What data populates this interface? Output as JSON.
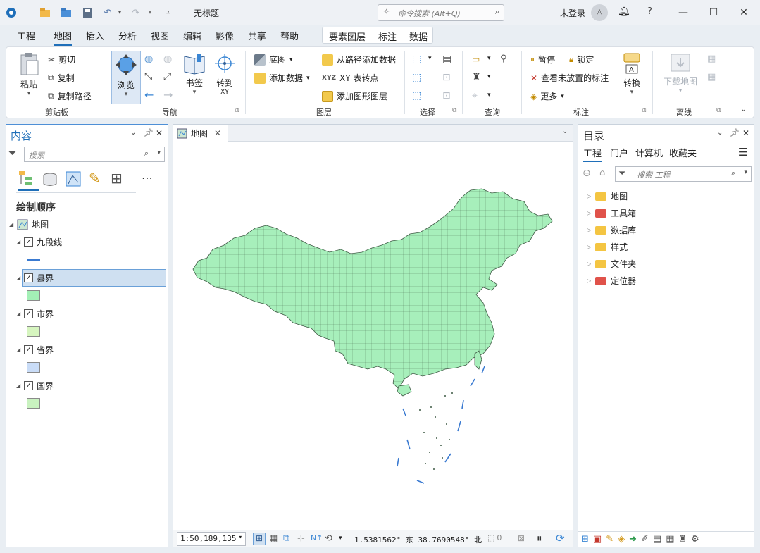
{
  "titlebar": {
    "doc_title": "无标题",
    "command_search_placeholder": "命令搜索 (Alt+Q)",
    "login": "未登录",
    "help": "?"
  },
  "menu": {
    "tabs": [
      "工程",
      "地图",
      "插入",
      "分析",
      "视图",
      "编辑",
      "影像",
      "共享",
      "帮助"
    ],
    "active_index": 1,
    "context_tabs": [
      "要素图层",
      "标注",
      "数据"
    ]
  },
  "ribbon": {
    "clipboard": {
      "label": "剪贴板",
      "paste": "粘贴",
      "cut": "剪切",
      "copy": "复制",
      "copy_path": "复制路径"
    },
    "navigate": {
      "label": "导航",
      "explore": "浏览",
      "bookmarks": "书签",
      "goto_xy": "转到",
      "goto_xy_sub": "XY"
    },
    "layer": {
      "label": "图层",
      "basemap": "底图",
      "add_data": "添加数据",
      "add_from_path": "从路径添加数据",
      "xy_to_point": "XY 表转点",
      "add_graphics_layer": "添加图形图层"
    },
    "selection": {
      "label": "选择"
    },
    "inquiry": {
      "label": "查询"
    },
    "labeling": {
      "label": "标注",
      "pause": "暂停",
      "lock": "锁定",
      "view_unplaced": "查看未放置的标注",
      "more": "更多",
      "convert": "转换"
    },
    "offline": {
      "label": "离线",
      "download_map": "下载地图"
    }
  },
  "contents": {
    "title": "内容",
    "search_placeholder": "搜索",
    "drawing_order": "绘制顺序",
    "map_name": "地图",
    "layers": [
      {
        "name": "九段线",
        "checked": true,
        "symbol": "line",
        "color": "#3a7ad1"
      },
      {
        "name": "县界",
        "checked": true,
        "symbol": "fill",
        "color": "#a3f0b6",
        "selected": true
      },
      {
        "name": "市界",
        "checked": true,
        "symbol": "fill",
        "color": "#d6f5bf"
      },
      {
        "name": "省界",
        "checked": true,
        "symbol": "fill",
        "color": "#c9dcf7"
      },
      {
        "name": "国界",
        "checked": true,
        "symbol": "fill",
        "color": "#c9f2c0"
      }
    ]
  },
  "mapview": {
    "tab": "地图",
    "scale": "1:50,189,135",
    "coords": "1.5381562° 东 38.7690548° 北",
    "selected_count": "0",
    "fill_color": "#a7efbb"
  },
  "catalog": {
    "title": "目录",
    "tabs": [
      "工程",
      "门户",
      "计算机",
      "收藏夹"
    ],
    "search_placeholder": "搜索 工程",
    "items": [
      "地图",
      "工具箱",
      "数据库",
      "样式",
      "文件夹",
      "定位器"
    ]
  }
}
